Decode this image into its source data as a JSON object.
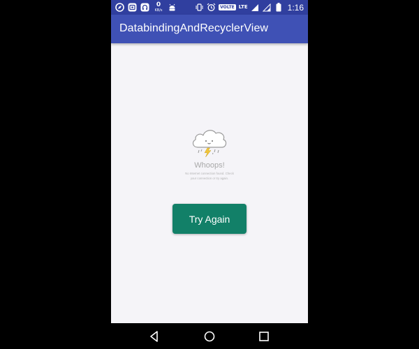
{
  "status_bar": {
    "net_speed_value": "0",
    "net_speed_unit": "KB/s",
    "volte_label": "VOLTE",
    "lte_label": "LTE",
    "time": "1:16",
    "icons": [
      "compass-icon",
      "photo-app-icon",
      "headphones-app-icon",
      "android-icon",
      "vibrate-icon",
      "alarm-icon",
      "signal-icon",
      "battery-icon"
    ]
  },
  "app_bar": {
    "title": "DatabindingAndRecyclerView"
  },
  "empty_state": {
    "icon": "storm-cloud-icon",
    "heading": "Whoops!",
    "message_line1": "No Internet connection found. Check",
    "message_line2": "your connection or try again.",
    "retry_label": "Try Again"
  },
  "nav_bar": {
    "buttons": [
      "back-icon",
      "home-icon",
      "recents-icon"
    ]
  },
  "colors": {
    "status_bar": "#303f9f",
    "app_bar": "#3f51b5",
    "background": "#f5f4f8",
    "button": "#128068",
    "text_muted": "#a8a8a8"
  }
}
